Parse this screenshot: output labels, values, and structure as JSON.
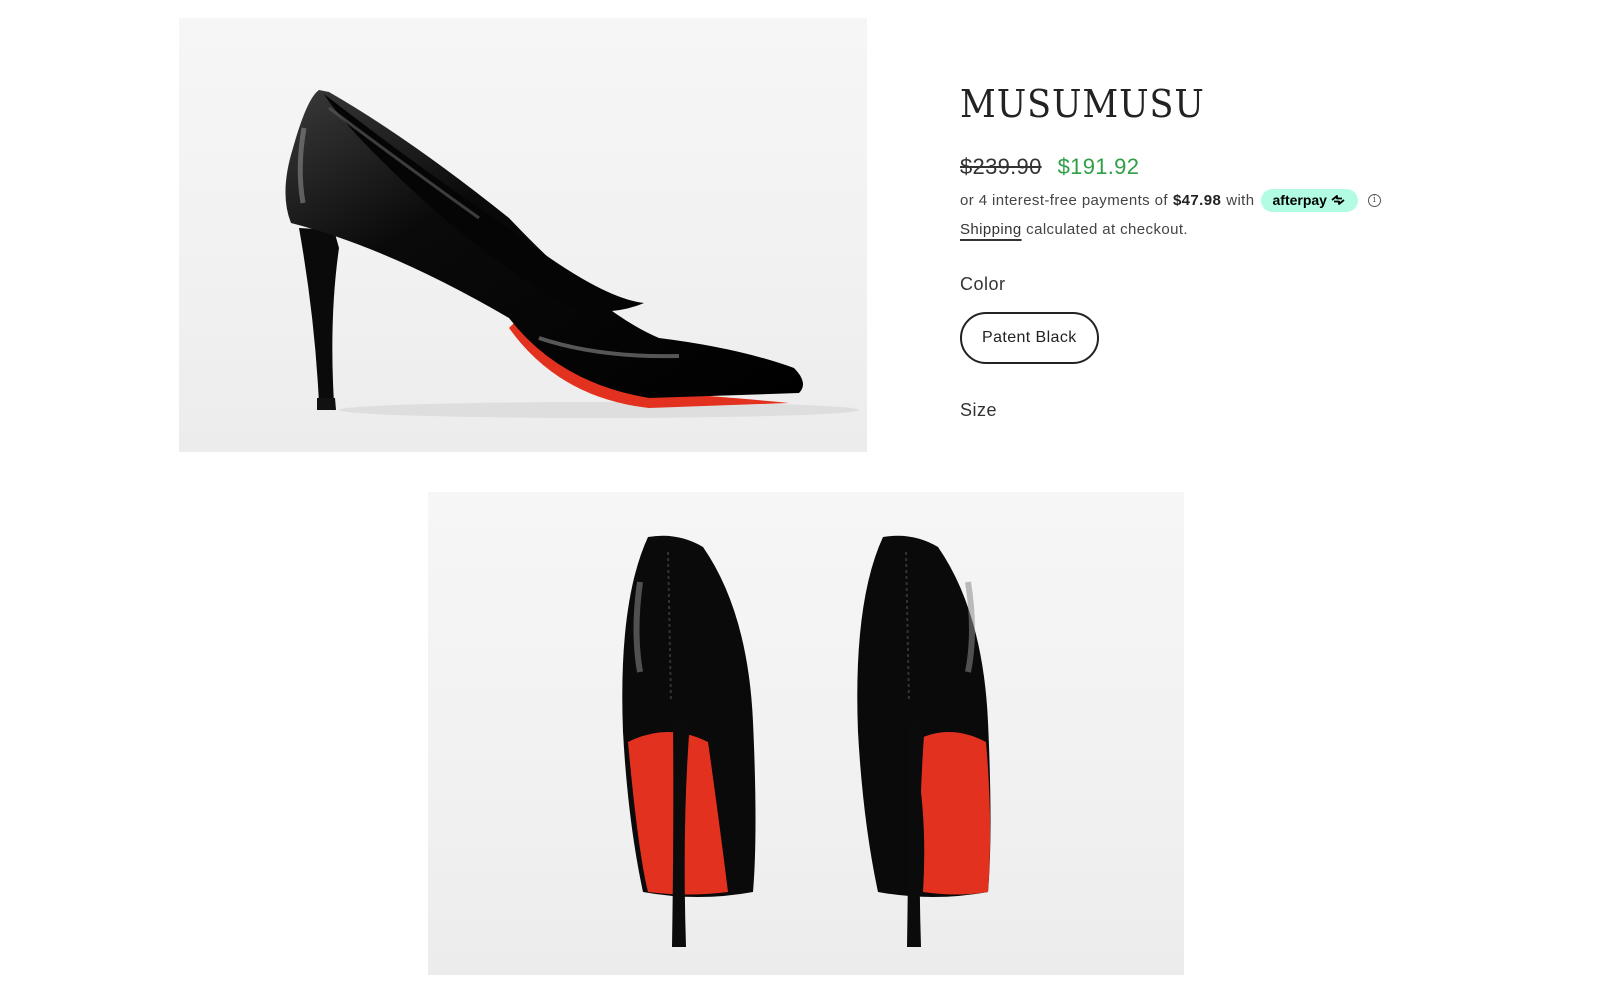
{
  "product": {
    "vendor": "MUSUMUSU",
    "compare_price": "$239.90",
    "sale_price": "$191.92"
  },
  "afterpay": {
    "prefix": "or 4 interest-free payments of",
    "amount": "$47.98",
    "suffix": "with",
    "badge_label": "afterpay",
    "badge_color": "#b2fce4"
  },
  "shipping": {
    "link_label": "Shipping",
    "text": "calculated at checkout."
  },
  "options": {
    "color_label": "Color",
    "color_selected": "Patent Black",
    "size_label": "Size"
  },
  "colors": {
    "sale_price": "#2f9e44",
    "sole_red": "#e2321f",
    "patent_black": "#0b0b0b"
  }
}
